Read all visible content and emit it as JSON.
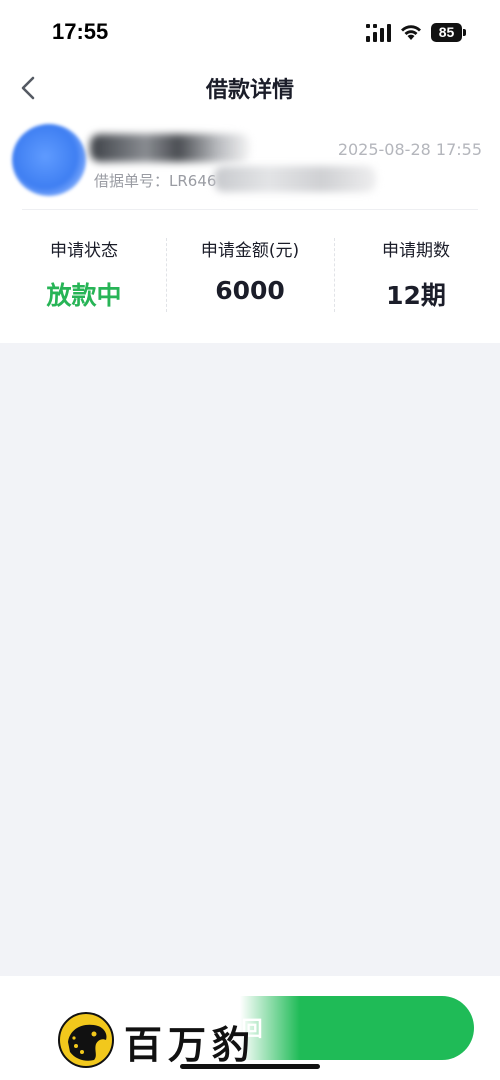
{
  "status_bar": {
    "time": "17:55",
    "battery": "85",
    "icons": [
      "signal-icon",
      "wifi-icon",
      "battery-icon"
    ]
  },
  "nav": {
    "title": "借款详情",
    "back_icon": "chevron-left-icon"
  },
  "header": {
    "order_label": "借据单号：LR646",
    "apply_time": "2025-08-28  17:55"
  },
  "stats": [
    {
      "label": "申请状态",
      "value": "放款中",
      "color": "#27b456"
    },
    {
      "label": "申请金额(元)",
      "value": "6000",
      "color": "#1b1d29"
    },
    {
      "label": "申请期数",
      "value": "12期",
      "color": "#1b1d29"
    }
  ],
  "bottom": {
    "button_label": "回",
    "button_color": "#1fbb57"
  },
  "watermark": {
    "text": "百万豹",
    "logo_icon": "leopard-logo-icon"
  },
  "colors": {
    "background": "#f2f3f7",
    "accent_green": "#27b456"
  }
}
